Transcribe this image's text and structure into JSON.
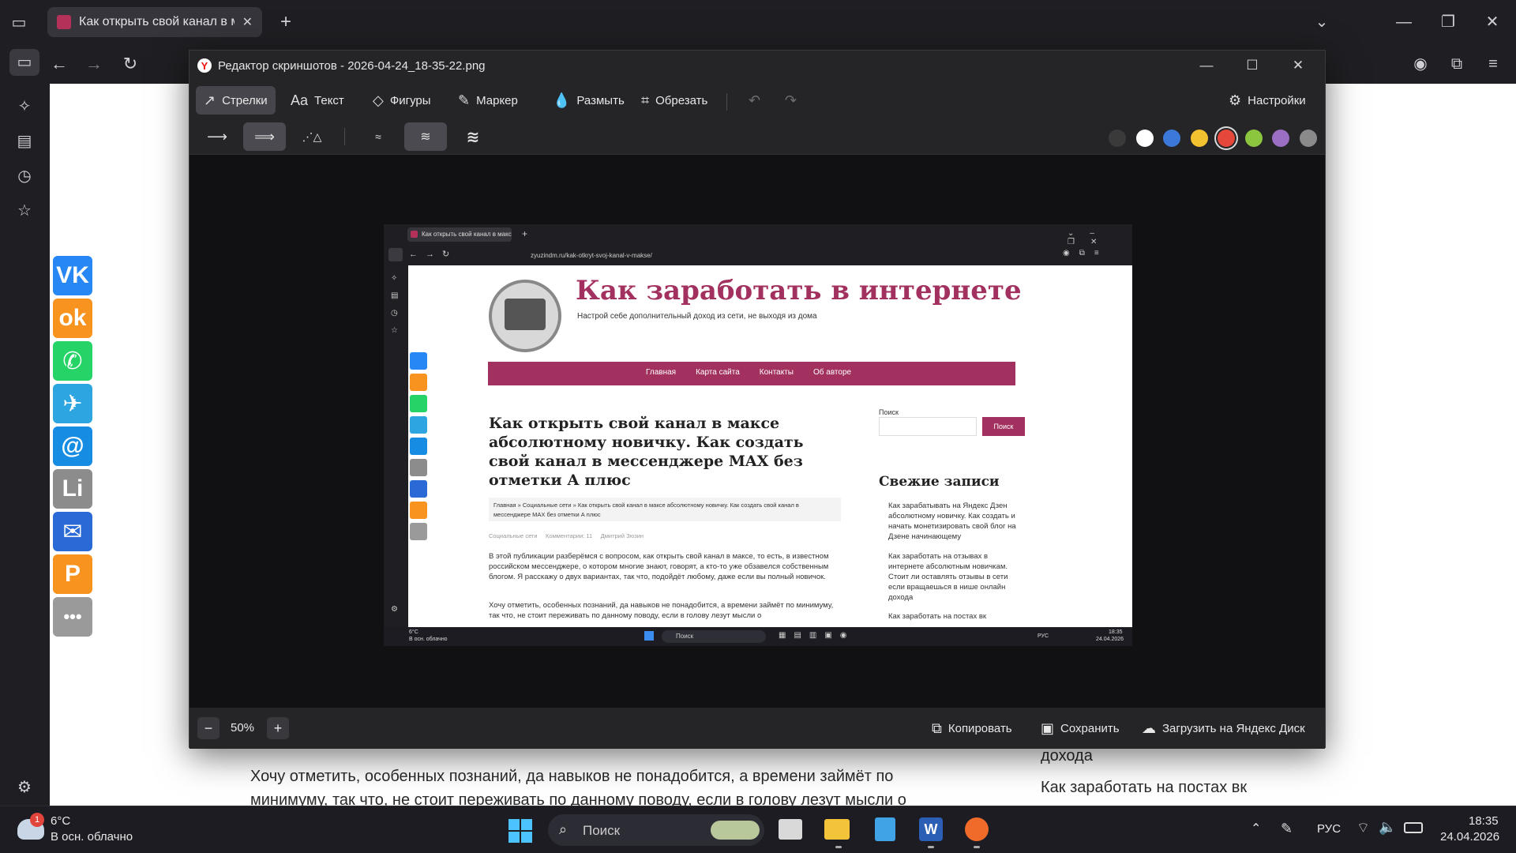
{
  "browser": {
    "tab_title": "Как открыть свой канал в макс",
    "new_tab": "+"
  },
  "page": {
    "paragraph_lines": [
      "Хочу отметить, особенных познаний, да навыков не понадобится, а времени займёт по",
      "минимуму, так что, не стоит переживать по данному поводу, если в голову лезут мысли о"
    ],
    "sidebar_right_lines": [
      "дохода",
      "Как заработать на постах вк"
    ]
  },
  "share_buttons": [
    {
      "name": "vk",
      "label": "VK",
      "color": "#2787f5"
    },
    {
      "name": "ok",
      "label": "ok",
      "color": "#f7931e"
    },
    {
      "name": "whatsapp",
      "label": "✆",
      "color": "#25d366"
    },
    {
      "name": "telegram",
      "label": "✈",
      "color": "#2ca5e0"
    },
    {
      "name": "mail",
      "label": "@",
      "color": "#168de2"
    },
    {
      "name": "liveinternet",
      "label": "Li",
      "color": "#8c8c8c"
    },
    {
      "name": "email",
      "label": "✉",
      "color": "#2a6ad6"
    },
    {
      "name": "pinterest",
      "label": "P",
      "color": "#f7931e"
    },
    {
      "name": "more",
      "label": "•••",
      "color": "#9a9a9a"
    }
  ],
  "editor": {
    "title": "Редактор скриншотов - 2026-04-24_18-35-22.png",
    "tools": [
      {
        "name": "arrows",
        "label": "Стрелки",
        "icon": "↗",
        "active": true
      },
      {
        "name": "text",
        "label": "Текст",
        "icon": "Aa",
        "active": false
      },
      {
        "name": "shapes",
        "label": "Фигуры",
        "icon": "◇",
        "active": false
      },
      {
        "name": "marker",
        "label": "Маркер",
        "icon": "✎",
        "active": false
      },
      {
        "name": "blur",
        "label": "Размыть",
        "icon": "💧",
        "active": false
      },
      {
        "name": "crop",
        "label": "Обрезать",
        "icon": "⌗",
        "active": false
      }
    ],
    "settings_label": "Настройки",
    "colors": [
      "#3a3a3a",
      "#ffffff",
      "#3b78d8",
      "#f2c230",
      "#e5483b",
      "#8cc63f",
      "#9b6fc4",
      "#8a8a8a"
    ],
    "active_color_index": 4,
    "zoom": "50%",
    "copy_label": "Копировать",
    "save_label": "Сохранить",
    "upload_label": "Загрузить на Яндекс Диск"
  },
  "mini": {
    "tab_title": "Как открыть свой канал в макс",
    "url": "zyuzindm.ru/kak-otkryt-svoj-kanal-v-makse/",
    "site_title": "Как заработать в интернете",
    "site_tagline": "Настрой себе дополнительный доход из сети, не выходя из дома",
    "menu": [
      "Главная",
      "Карта сайта",
      "Контакты",
      "Об авторе"
    ],
    "article_title": "Как открыть свой канал в максе абсолютному новичку. Как создать свой канал в мессенджере MAX без отметки А плюс",
    "breadcrumbs": "Главная » Социальные сети » Как открыть свой канал в максе абсолютному новичку. Как создать свой канал в мессенджере MAX без отметки А плюс",
    "meta": "Социальные сети     Комментарии: 11     Дмитрий Зюзин",
    "para1": "В этой публикации разберёмся с вопросом, как открыть свой канал в максе, то есть, в известном российском мессенджере, о котором многие знают, говорят, а кто-то уже обзавелся собственным блогом. Я расскажу о двух вариантах, так что, подойдёт любому, даже если вы полный новичок.",
    "para2": "Хочу отметить, особенных познаний, да навыков не понадобится, а времени займёт по минимуму, так что, не стоит переживать по данному поводу, если в голову лезут мысли о",
    "search_label": "Поиск",
    "search_button": "Поиск",
    "recent_title": "Свежие записи",
    "recent": [
      "Как зарабатывать на Яндекс Дзен абсолютному новичку. Как создать и начать монетизировать свой блог на Дзене начинающему",
      "Как заработать на отзывах в интернете абсолютным новичкам. Стоит ли оставлять отзывы в сети если вращаешься в нише онлайн дохода",
      "Как заработать на постах вк"
    ],
    "weather": "6°C",
    "weather_desc": "В осн. облачно",
    "search": "Поиск",
    "lang": "РУС",
    "time": "18:35",
    "date": "24.04.2026"
  },
  "taskbar": {
    "temp": "6°C",
    "weather_desc": "В осн. облачно",
    "badge": "1",
    "search": "Поиск",
    "lang": "РУС",
    "time": "18:35",
    "date": "24.04.2026"
  }
}
